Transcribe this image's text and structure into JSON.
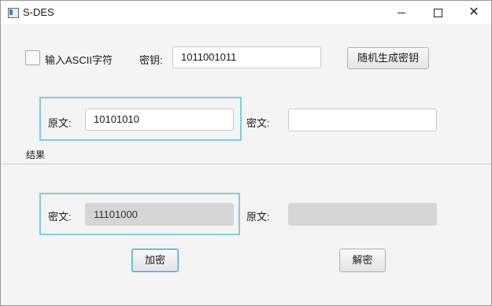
{
  "window": {
    "title": "S-DES",
    "controls": {
      "minimize": "minimize-icon",
      "maximize": "maximize-icon",
      "close": "close-icon"
    }
  },
  "options": {
    "ascii_label": "输入ASCII字符",
    "ascii_checked": false,
    "key_label": "密钥:",
    "key_value": "1011001011",
    "random_key_button": "随机生成密钥"
  },
  "encrypt_input": {
    "plaintext_label": "原文:",
    "plaintext_value": "10101010",
    "ciphertext_label": "密文:",
    "ciphertext_value": ""
  },
  "result": {
    "section_label": "结果",
    "ciphertext_label": "密文:",
    "ciphertext_value": "11101000",
    "plaintext_label": "原文:",
    "plaintext_value": ""
  },
  "actions": {
    "encrypt_button": "加密",
    "decrypt_button": "解密"
  },
  "colors": {
    "focus_border": "#7ccfe4",
    "window_bg": "#f4f4f4"
  }
}
